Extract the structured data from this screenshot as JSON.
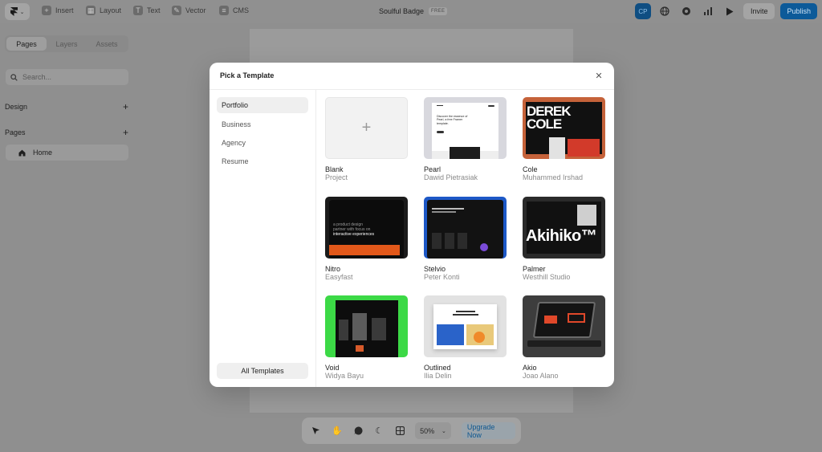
{
  "toolbar": {
    "items": [
      {
        "label": "Insert",
        "icon": "plus-square-icon"
      },
      {
        "label": "Layout",
        "icon": "layout-icon"
      },
      {
        "label": "Text",
        "icon": "text-icon"
      },
      {
        "label": "Vector",
        "icon": "pen-icon"
      },
      {
        "label": "CMS",
        "icon": "database-icon"
      }
    ],
    "project_name": "Soulful Badge",
    "plan_badge": "FREE",
    "avatar_initials": "CP",
    "invite_label": "Invite",
    "publish_label": "Publish"
  },
  "sidebar": {
    "tabs": [
      "Pages",
      "Layers",
      "Assets"
    ],
    "active_tab": "Pages",
    "search_placeholder": "Search...",
    "design_label": "Design",
    "pages_label": "Pages",
    "pages": [
      "Home"
    ]
  },
  "bottom_toolbar": {
    "zoom": "50%",
    "upgrade_label": "Upgrade Now"
  },
  "modal": {
    "title": "Pick a Template",
    "categories": [
      "Portfolio",
      "Business",
      "Agency",
      "Resume"
    ],
    "active_category": "Portfolio",
    "all_templates_label": "All Templates",
    "templates": [
      {
        "name": "Blank",
        "author": "Project"
      },
      {
        "name": "Pearl",
        "author": "Dawid Pietrasiak"
      },
      {
        "name": "Cole",
        "author": "Muhammed Irshad"
      },
      {
        "name": "Nitro",
        "author": "Easyfast"
      },
      {
        "name": "Stelvio",
        "author": "Peter Konti"
      },
      {
        "name": "Palmer",
        "author": "Westhill Studio"
      },
      {
        "name": "Void",
        "author": "Widya Bayu"
      },
      {
        "name": "Outlined",
        "author": "Ilia Delin"
      },
      {
        "name": "Akio",
        "author": "Joao Alano"
      }
    ],
    "thumb_text": {
      "cole": "DEREK COLE",
      "palmer": "Akihiko™",
      "pearl_heading": "Discover the essence of Pearl, a free Framer template.",
      "nitro_lines": [
        "a product design",
        "partner with focus on",
        "interactive experiences"
      ]
    }
  },
  "colors": {
    "accent": "#0c5a99",
    "overlay": "#8f8f8f",
    "modal_bg": "#ffffff"
  }
}
